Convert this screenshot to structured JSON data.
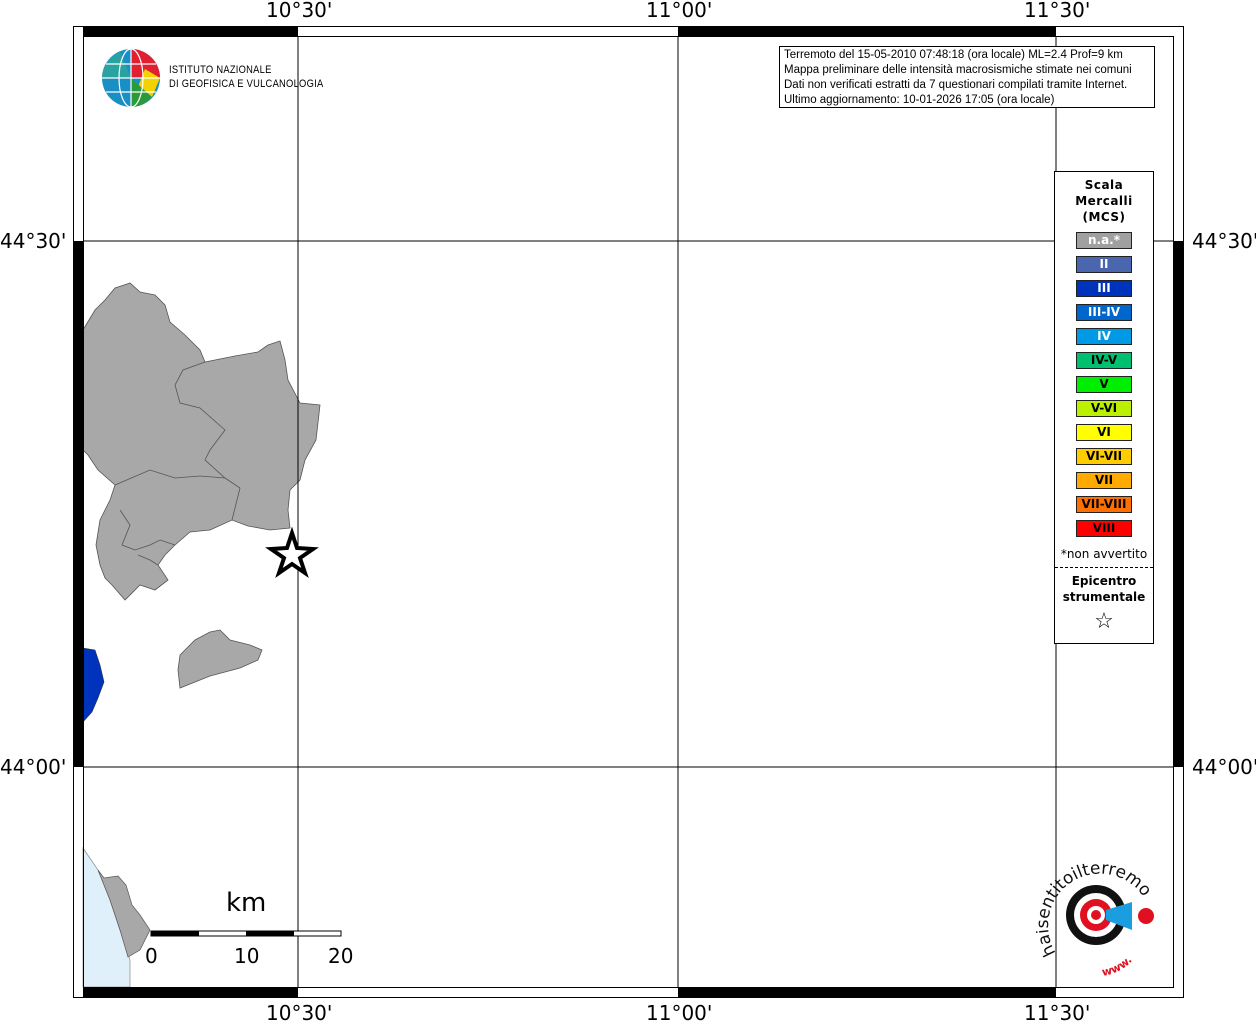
{
  "map": {
    "lon_labels": [
      "10°30'",
      "11°00'",
      "11°30'"
    ],
    "lat_labels": [
      "44°30'",
      "44°00'"
    ]
  },
  "logo": {
    "line1": "ISTITUTO NAZIONALE",
    "line2": "DI GEOFISICA E VULCANOLOGIA"
  },
  "info": {
    "line1": "Terremoto del 15-05-2010 07:48:18 (ora locale) ML=2.4 Prof=9 km",
    "line2": "Mappa preliminare delle intensità macrosismiche stimate nei comuni",
    "line3": "Dati non verificati estratti da 7 questionari compilati tramite Internet.",
    "line4": "Ultimo aggiornamento: 10-01-2026 17:05 (ora locale)"
  },
  "legend": {
    "title1": "Scala",
    "title2": "Mercalli",
    "title3": "(MCS)",
    "items": [
      {
        "label": "n.a.*",
        "color": "#a0a0a0",
        "text": "#ffffff"
      },
      {
        "label": "II",
        "color": "#4a66ae",
        "text": "#ffffff"
      },
      {
        "label": "III",
        "color": "#0033bb",
        "text": "#ffffff"
      },
      {
        "label": "III-IV",
        "color": "#0066cc",
        "text": "#ffffff"
      },
      {
        "label": "IV",
        "color": "#0099e6",
        "text": "#ffffff"
      },
      {
        "label": "IV-V",
        "color": "#00c070",
        "text": "#000000"
      },
      {
        "label": "V",
        "color": "#00ee00",
        "text": "#000000"
      },
      {
        "label": "V-VI",
        "color": "#bbf000",
        "text": "#000000"
      },
      {
        "label": "VI",
        "color": "#ffff00",
        "text": "#000000"
      },
      {
        "label": "VI-VII",
        "color": "#ffcc00",
        "text": "#000000"
      },
      {
        "label": "VII",
        "color": "#ffaa00",
        "text": "#000000"
      },
      {
        "label": "VII-VIII",
        "color": "#ff7000",
        "text": "#000000"
      },
      {
        "label": "VIII",
        "color": "#ff0000",
        "text": "#000000"
      }
    ],
    "note": "*non avvertito",
    "epi1": "Epicentro",
    "epi2": "strumentale",
    "star": "☆"
  },
  "scale": {
    "unit": "km",
    "ticks": [
      "0",
      "10",
      "20"
    ]
  },
  "hsi_logo": {
    "text": "haisentitoilterremoto.it",
    "url": "www."
  }
}
